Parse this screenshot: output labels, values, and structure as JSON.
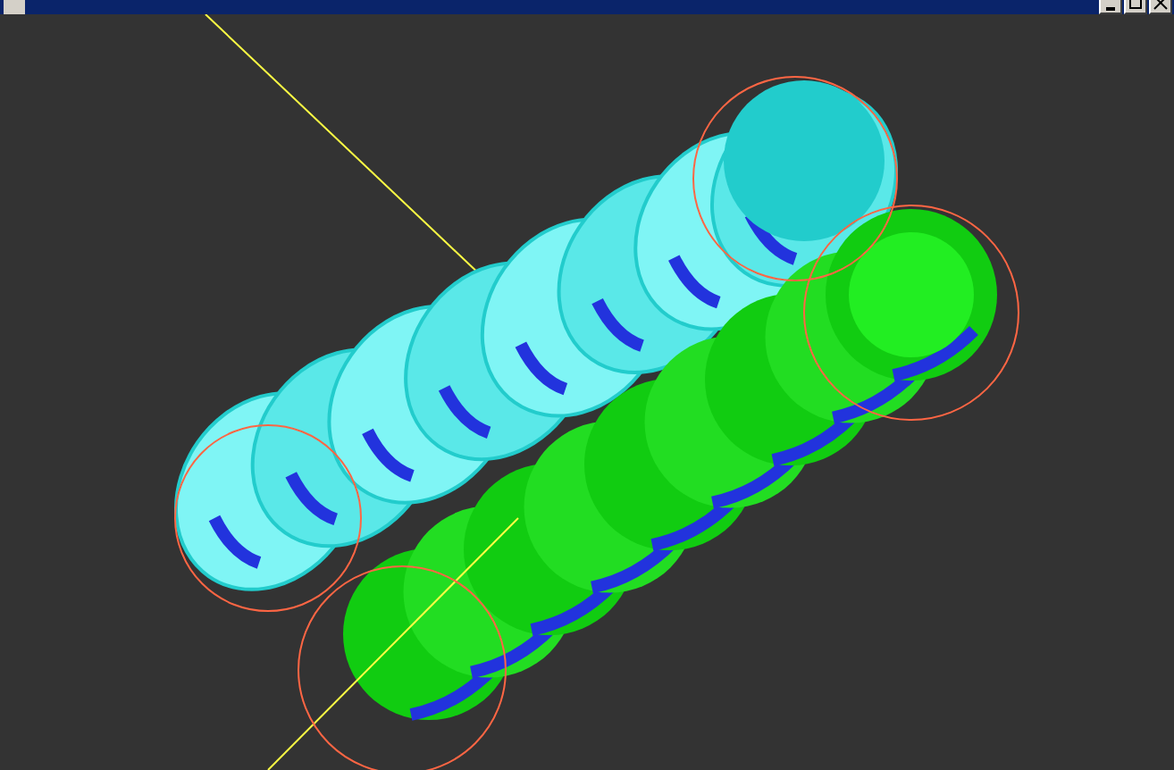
{
  "window": {
    "buttons": [
      {
        "kind": "minimize"
      },
      {
        "kind": "maximize"
      },
      {
        "kind": "close"
      }
    ]
  }
}
